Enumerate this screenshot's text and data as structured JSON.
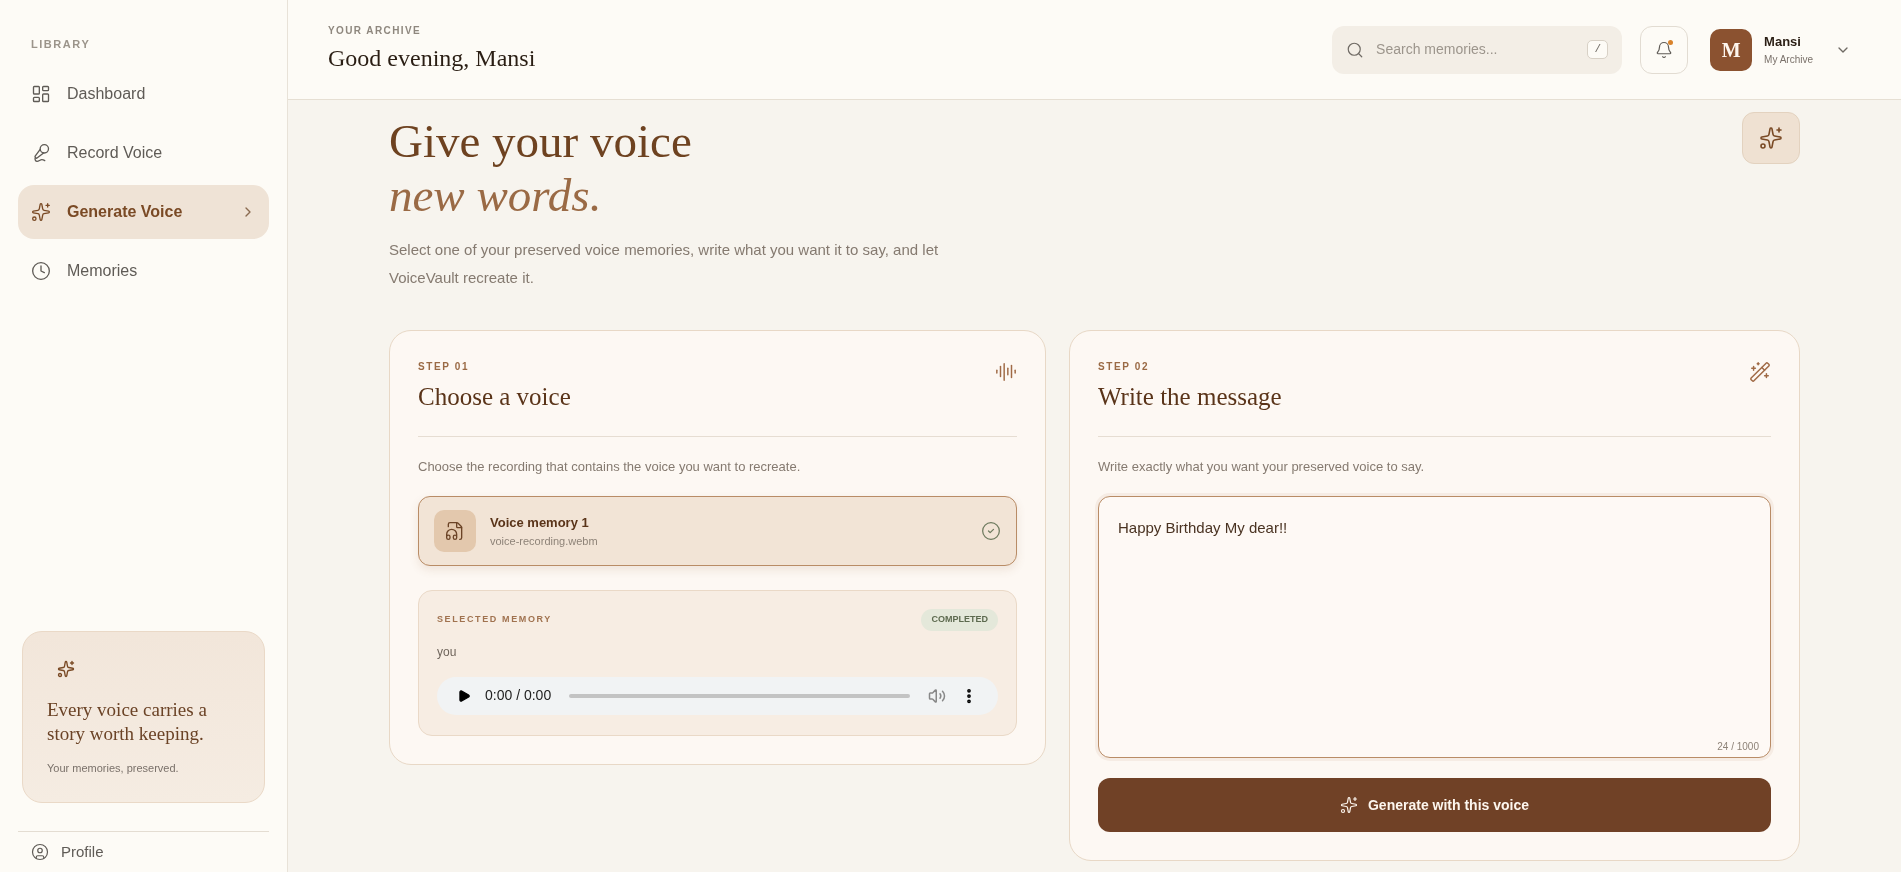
{
  "sidebar": {
    "section_label": "LIBRARY",
    "items": [
      {
        "label": "Dashboard",
        "selected": false
      },
      {
        "label": "Record Voice",
        "selected": false
      },
      {
        "label": "Generate Voice",
        "selected": true
      },
      {
        "label": "Memories",
        "selected": false
      }
    ],
    "promo": {
      "title": "Every voice carries a story worth keeping.",
      "subtitle": "Your memories, preserved."
    },
    "footer_item": {
      "label": "Profile"
    }
  },
  "header": {
    "eyebrow": "YOUR ARCHIVE",
    "greeting": "Good evening, Mansi",
    "search": {
      "placeholder": "Search memories...",
      "shortcut": "/"
    },
    "notifications": {
      "unread": true
    },
    "user": {
      "initial": "M",
      "name": "Mansi",
      "subtitle": "My Archive"
    }
  },
  "hero": {
    "title": "Give your voice",
    "title_accent": "new words.",
    "description": "Select one of your preserved voice memories, write what you want it to say, and let VoiceVault recreate it."
  },
  "step1": {
    "step": "STEP 01",
    "title": "Choose a voice",
    "hint": "Choose the recording that contains the voice you want to recreate.",
    "voices": [
      {
        "name": "Voice memory 1",
        "file": "voice-recording.webm",
        "selected": true
      }
    ],
    "selected_memory": {
      "label": "SELECTED MEMORY",
      "status": "COMPLETED",
      "transcript": "you",
      "time": "0:00 / 0:00"
    }
  },
  "step2": {
    "step": "STEP 02",
    "title": "Write the message",
    "hint": "Write exactly what you want your preserved voice to say.",
    "message": "Happy Birthday My dear!!",
    "counter": "24 / 1000",
    "button": "Generate with this voice"
  }
}
